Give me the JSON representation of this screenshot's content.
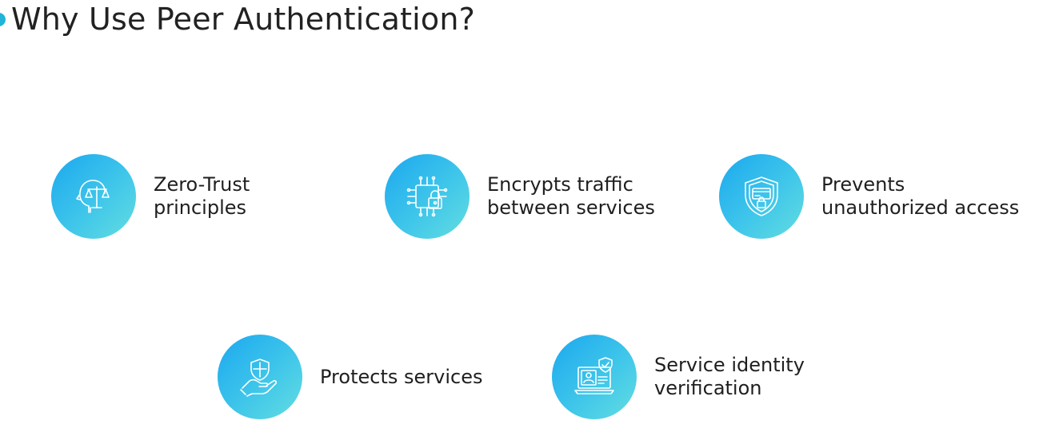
{
  "slide": {
    "title": "Why Use Peer Authentication?"
  },
  "features": [
    {
      "icon": "justice-head-icon",
      "line1": "Zero-Trust",
      "line2": "principles"
    },
    {
      "icon": "circuit-lock-icon",
      "line1": "Encrypts traffic",
      "line2": "between services"
    },
    {
      "icon": "shield-card-lock-icon",
      "line1": "Prevents",
      "line2": "unauthorized access"
    },
    {
      "icon": "hand-shield-icon",
      "line1": "Protects services",
      "line2": ""
    },
    {
      "icon": "laptop-identity-check-icon",
      "line1": "Service identity",
      "line2": "verification"
    }
  ],
  "colors": {
    "accent": "#20b4d8",
    "circle_start": "#1ba8ef",
    "circle_end": "#63dde0",
    "text": "#1f1f1f"
  }
}
